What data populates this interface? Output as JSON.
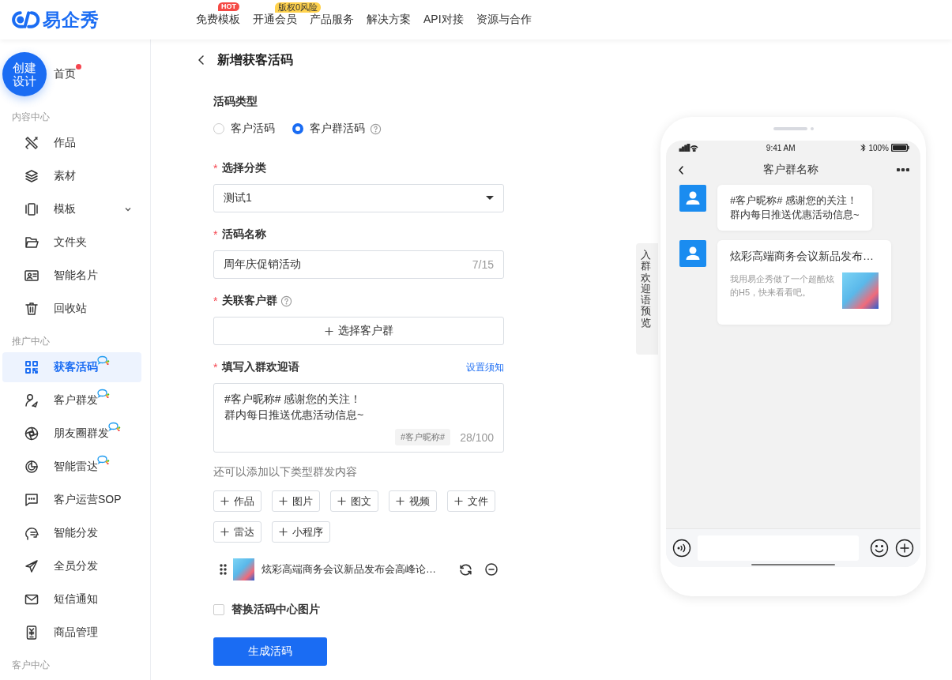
{
  "header": {
    "logo": "易企秀",
    "nav": [
      {
        "label": "免费模板",
        "badge": "HOT",
        "kind": "hot"
      },
      {
        "label": "开通会员",
        "badge": "版权0风险",
        "kind": "promo"
      },
      {
        "label": "产品服务"
      },
      {
        "label": "解决方案"
      },
      {
        "label": "API对接"
      },
      {
        "label": "资源与合作"
      }
    ]
  },
  "sidebar": {
    "create_button": "创建设计",
    "home": {
      "label": "首页",
      "unread": true
    },
    "sections": [
      {
        "title": "内容中心",
        "items": [
          {
            "label": "作品",
            "selected": false,
            "badge": false
          },
          {
            "label": "素材",
            "selected": false,
            "badge": false
          },
          {
            "label": "模板",
            "selected": false,
            "badge": false,
            "expanded": false
          },
          {
            "label": "文件夹",
            "selected": false,
            "badge": false
          },
          {
            "label": "智能名片",
            "selected": false,
            "badge": false
          },
          {
            "label": "回收站",
            "selected": false,
            "badge": false
          }
        ]
      },
      {
        "title": "推广中心",
        "items": [
          {
            "label": "获客活码",
            "selected": true,
            "badge": true
          },
          {
            "label": "客户群发",
            "selected": false,
            "badge": true
          },
          {
            "label": "朋友圈群发",
            "selected": false,
            "badge": true
          },
          {
            "label": "智能雷达",
            "selected": false,
            "badge": true
          },
          {
            "label": "客户运营SOP",
            "selected": false,
            "badge": false
          },
          {
            "label": "智能分发",
            "selected": false,
            "badge": false
          },
          {
            "label": "全员分发",
            "selected": false,
            "badge": false
          },
          {
            "label": "短信通知",
            "selected": false,
            "badge": false
          },
          {
            "label": "商品管理",
            "selected": false,
            "badge": false
          }
        ]
      },
      {
        "title": "客户中心"
      }
    ]
  },
  "page": {
    "title": "新增获客活码"
  },
  "form": {
    "type_field": {
      "label": "活码类型",
      "options": [
        {
          "label": "客户活码",
          "selected": false,
          "help": false
        },
        {
          "label": "客户群活码",
          "selected": true,
          "help": true
        }
      ]
    },
    "category": {
      "required_mark": "*",
      "label": "选择分类",
      "value": "测试1"
    },
    "name": {
      "required_mark": "*",
      "label": "活码名称",
      "value": "周年庆促销活动",
      "counter": "7/15"
    },
    "group": {
      "required_mark": "*",
      "label": "关联客户群",
      "help": true,
      "button": "选择客户群"
    },
    "welcome": {
      "required_mark": "*",
      "label": "填写入群欢迎语",
      "link": "设置须知",
      "lines": [
        "#客户昵称# 感谢您的关注！",
        "群内每日推送优惠活动信息~"
      ],
      "tag": "#客户昵称#",
      "counter": "28/100"
    },
    "extra_hint": "还可以添加以下类型群发内容",
    "add_buttons": [
      "作品",
      "图片",
      "图文",
      "视频",
      "文件",
      "雷达",
      "小程序"
    ],
    "attachments": [
      {
        "title": "炫彩高端商务会议新品发布会高峰论…"
      }
    ],
    "replace_image": {
      "label": "替换活码中心图片",
      "checked": false
    },
    "submit": "生成活码"
  },
  "preview": {
    "side_tab": "入群欢迎语预览",
    "time": "9:41 AM",
    "battery": "100%",
    "chat_title": "客户群名称",
    "messages": [
      {
        "kind": "text",
        "lines": [
          "#客户昵称# 感谢您的关注！",
          "群内每日推送优惠活动信息~"
        ]
      },
      {
        "kind": "link",
        "title": "炫彩高端商务会议新品发布…",
        "desc": "我用易企秀做了一个超酷炫的H5，快来看看吧。"
      }
    ]
  }
}
